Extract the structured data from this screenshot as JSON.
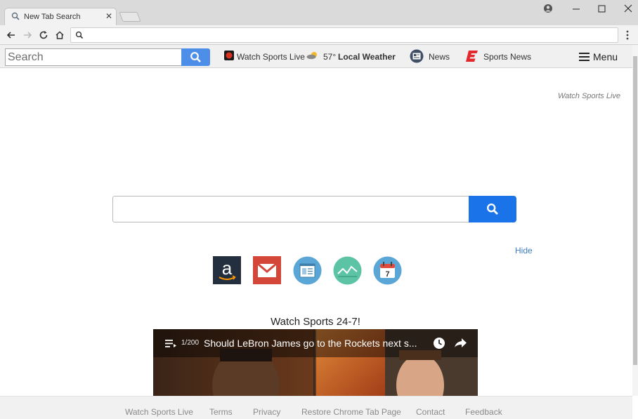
{
  "browser": {
    "tab_title": "New Tab Search",
    "tab_close": "✕",
    "window_controls": [
      "minimize-icon",
      "maximize-icon",
      "close-icon"
    ],
    "omnibox_value": ""
  },
  "extension_bar": {
    "search_placeholder": "Search",
    "items": [
      {
        "label": "Watch Sports Live",
        "icon": "sports-tv-icon"
      },
      {
        "temp": "57°",
        "label": "Local Weather",
        "icon": "weather-icon"
      },
      {
        "label": "News",
        "icon": "news-icon"
      },
      {
        "label": "Sports News",
        "icon": "espn-icon"
      }
    ],
    "menu_label": "Menu"
  },
  "main": {
    "brand": "Watch Sports Live",
    "search_value": "",
    "hide_label": "Hide",
    "tiles": [
      "amazon-icon",
      "gmail-icon",
      "news-icon",
      "stocks-icon",
      "calendar-icon"
    ],
    "calendar_day": "7",
    "amazon_letter": "a"
  },
  "video": {
    "heading": "Watch Sports 24-7!",
    "counter": "1/200",
    "caption": "Should LeBron James go to the Rockets next s..."
  },
  "footer": {
    "links": [
      "Watch Sports Live",
      "Terms",
      "Privacy",
      "Restore Chrome Tab Page",
      "Contact",
      "Feedback"
    ]
  },
  "colors": {
    "accent_blue": "#1a73e8",
    "ext_button_blue": "#4d8ee9",
    "amazon_bg": "#232f3e",
    "gmail_red": "#d44638",
    "tile_blue": "#5aa6d6",
    "tile_teal": "#5cc3a4"
  }
}
